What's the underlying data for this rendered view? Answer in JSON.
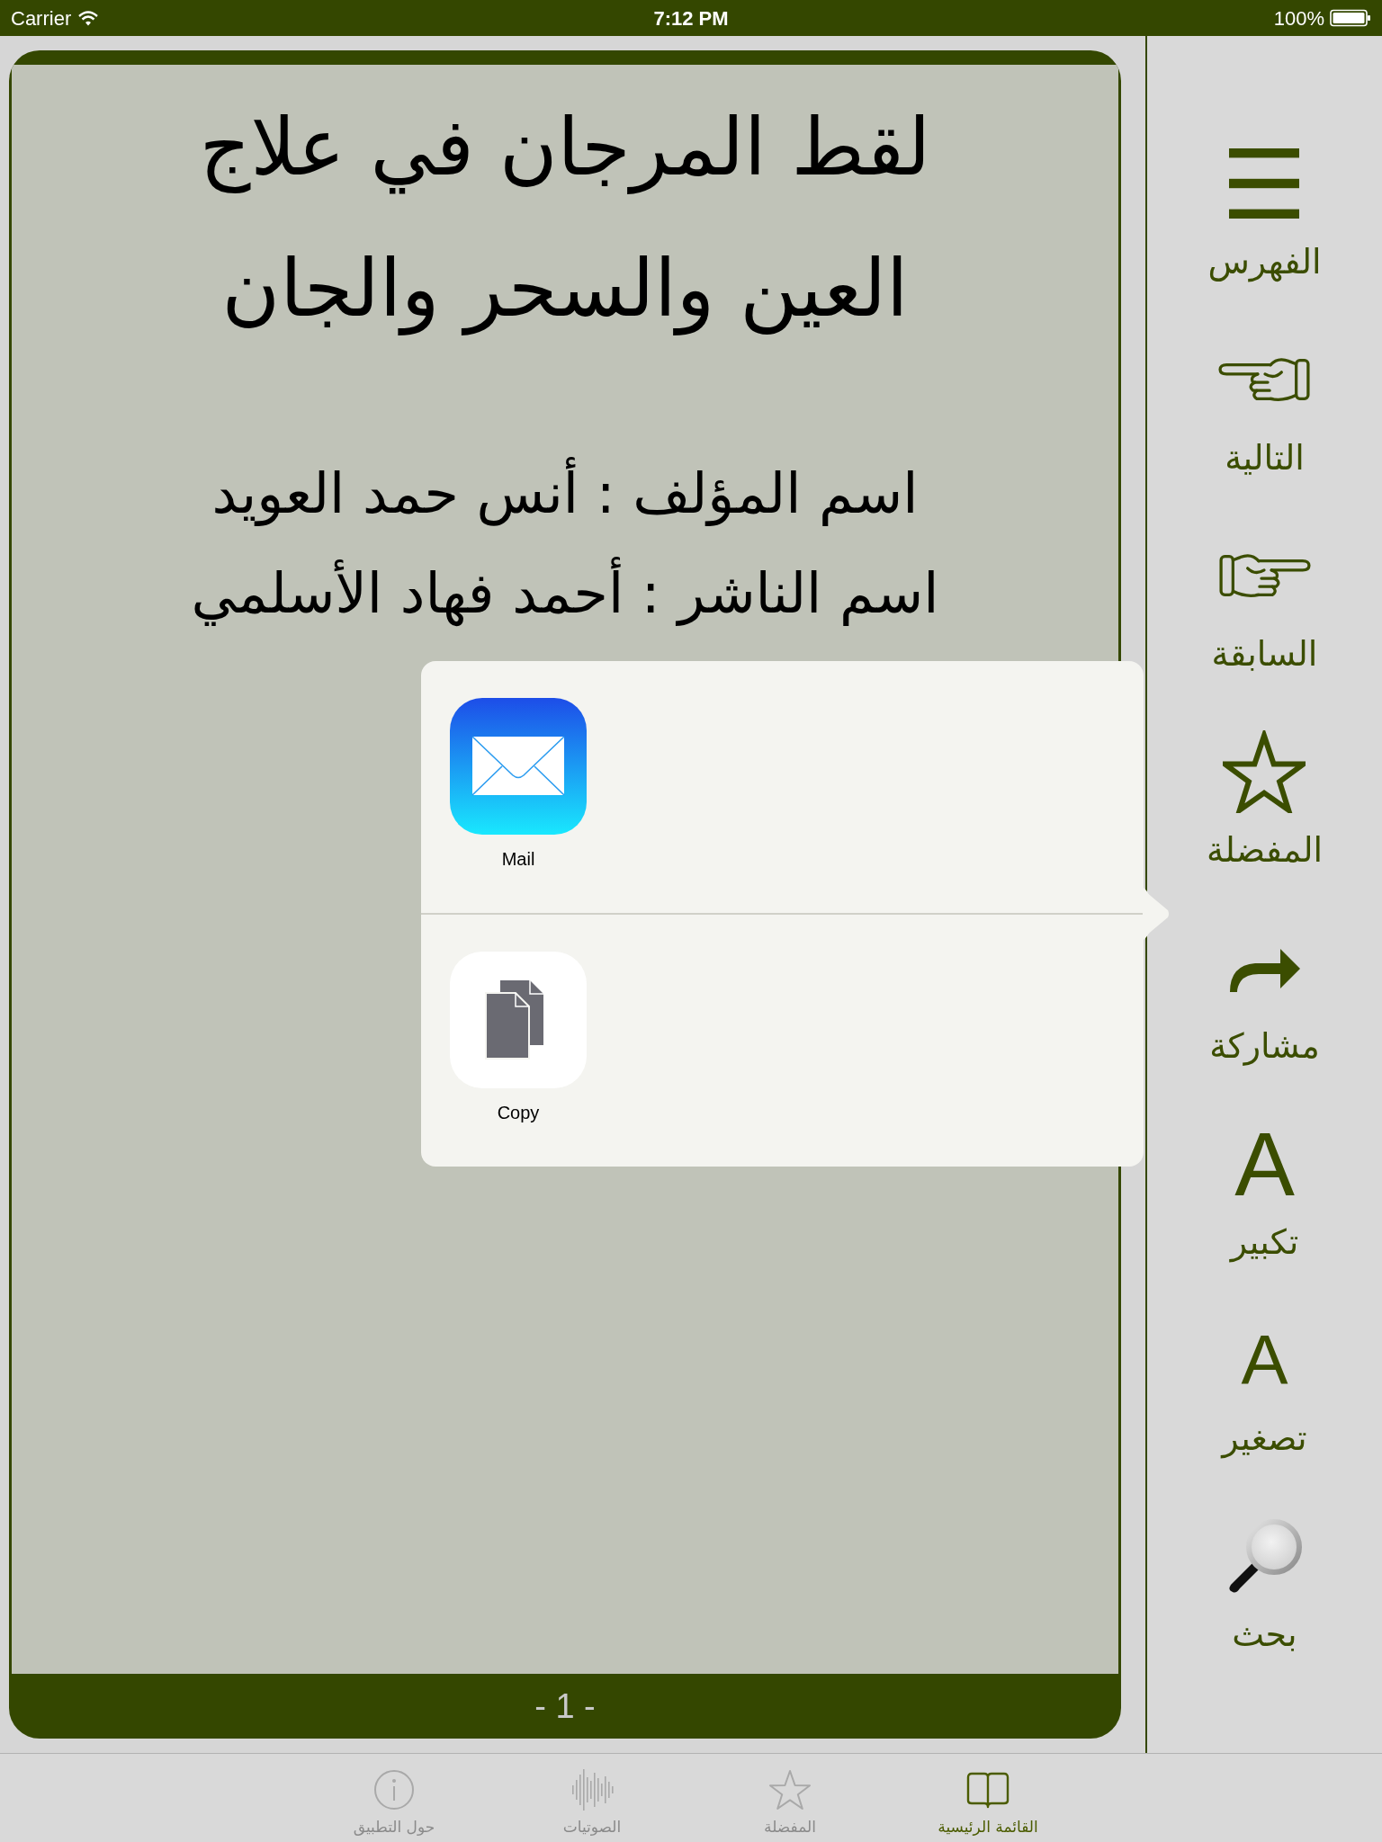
{
  "status_bar": {
    "carrier": "Carrier",
    "time": "7:12 PM",
    "battery": "100%"
  },
  "page": {
    "title_lines": [
      "لقط المرجان في علاج",
      "العين والسحر والجان"
    ],
    "author": "اسم المؤلف : أنس حمد العويد",
    "publisher": "اسم الناشر : أحمد فهاد الأسلمي",
    "page_number": "- 1 -"
  },
  "share_sheet": {
    "sections": [
      {
        "items": [
          {
            "kind": "mail",
            "label": "Mail"
          }
        ]
      },
      {
        "items": [
          {
            "kind": "copy",
            "label": "Copy"
          }
        ]
      }
    ]
  },
  "sidebar": {
    "items": [
      {
        "kind": "menu",
        "label": "الفهرس"
      },
      {
        "kind": "next",
        "label": "التالية"
      },
      {
        "kind": "previous",
        "label": "السابقة"
      },
      {
        "kind": "favorite",
        "label": "المفضلة"
      },
      {
        "kind": "share",
        "label": "مشاركة"
      },
      {
        "kind": "enlarge",
        "label": "تكبير",
        "glyph": "A"
      },
      {
        "kind": "shrink",
        "label": "تصغير",
        "glyph": "A"
      },
      {
        "kind": "search",
        "label": "بحث"
      }
    ]
  },
  "tab_bar": {
    "tabs": [
      {
        "kind": "home",
        "label": "القائمة الرئيسية",
        "selected": true
      },
      {
        "kind": "favorites",
        "label": "المفضلة",
        "selected": false
      },
      {
        "kind": "audio",
        "label": "الصوتيات",
        "selected": false
      },
      {
        "kind": "about",
        "label": "حول التطبيق",
        "selected": false
      }
    ]
  }
}
